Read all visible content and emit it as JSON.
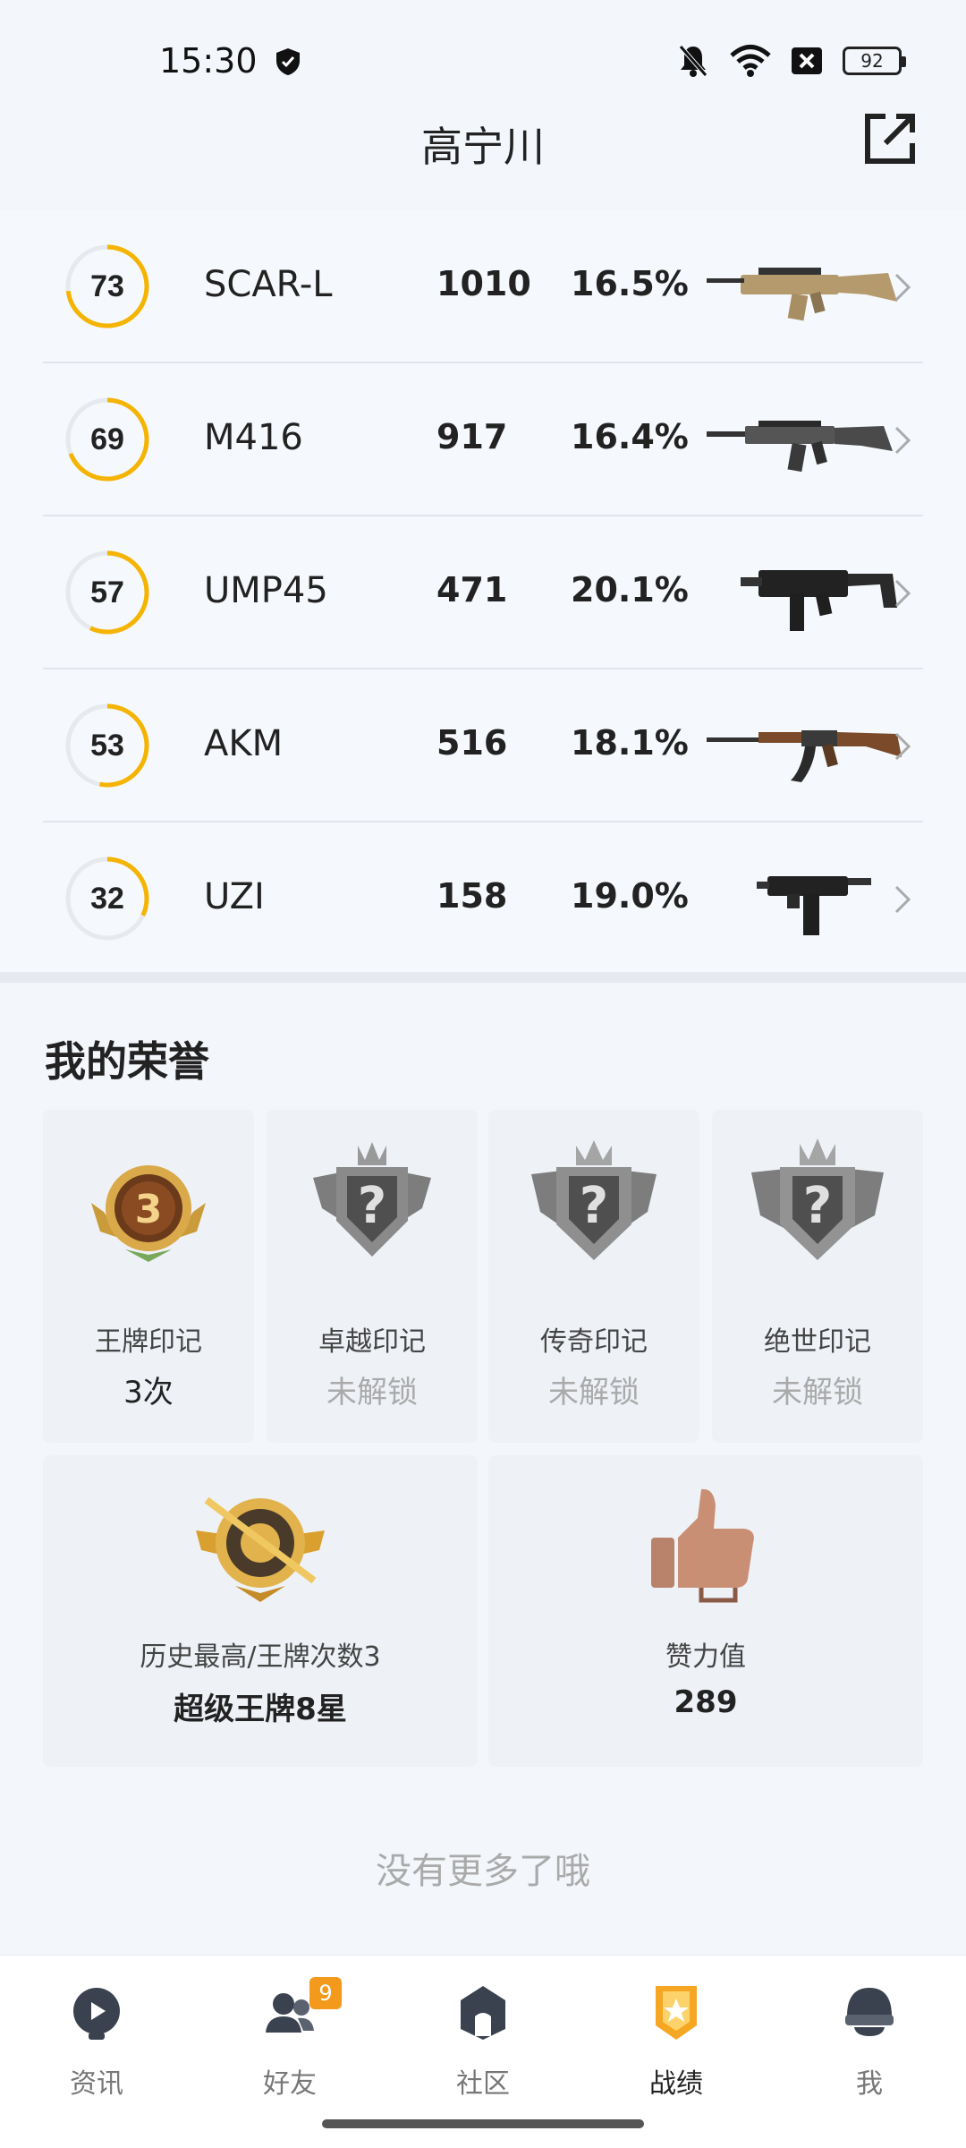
{
  "status_bar": {
    "time": "15:30",
    "battery": "92",
    "icons": [
      "shield-icon",
      "bell-muted-icon",
      "wifi-icon",
      "sim-off-icon",
      "battery-icon"
    ]
  },
  "header": {
    "title": "高宁川",
    "share_icon": "share-icon"
  },
  "weapons": [
    {
      "score": "73",
      "score_pct": 73,
      "name": "SCAR-L",
      "kills": "1010",
      "rate": "16.5%"
    },
    {
      "score": "69",
      "score_pct": 69,
      "name": "M416",
      "kills": "917",
      "rate": "16.4%"
    },
    {
      "score": "57",
      "score_pct": 57,
      "name": "UMP45",
      "kills": "471",
      "rate": "20.1%"
    },
    {
      "score": "53",
      "score_pct": 53,
      "name": "AKM",
      "kills": "516",
      "rate": "18.1%"
    },
    {
      "score": "32",
      "score_pct": 32,
      "name": "UZI",
      "kills": "158",
      "rate": "19.0%"
    }
  ],
  "honors": {
    "title": "我的荣誉",
    "marks": [
      {
        "name": "王牌印记",
        "value": "3次",
        "locked": false,
        "badge_number": "3"
      },
      {
        "name": "卓越印记",
        "value": "未解锁",
        "locked": true
      },
      {
        "name": "传奇印记",
        "value": "未解锁",
        "locked": true
      },
      {
        "name": "绝世印记",
        "value": "未解锁",
        "locked": true
      }
    ],
    "highest": {
      "name": "历史最高/王牌次数3",
      "value": "超级王牌8星"
    },
    "likes": {
      "name": "赞力值",
      "value": "289"
    }
  },
  "footer_text": "没有更多了哦",
  "nav": {
    "items": [
      {
        "label": "资讯",
        "icon": "news-icon",
        "active": false
      },
      {
        "label": "好友",
        "icon": "friends-icon",
        "active": false,
        "badge": "9"
      },
      {
        "label": "社区",
        "icon": "community-icon",
        "active": false
      },
      {
        "label": "战绩",
        "icon": "record-icon",
        "active": true
      },
      {
        "label": "我",
        "icon": "profile-icon",
        "active": false
      }
    ]
  },
  "colors": {
    "accent": "#f5b400",
    "ring_track": "#e6e9ee",
    "background": "#f3f6fb"
  }
}
